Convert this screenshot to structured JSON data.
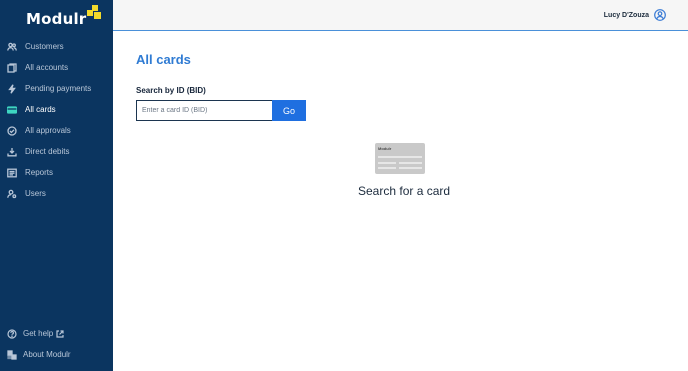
{
  "brand": {
    "name": "Modulr",
    "accent": "#f2da2c"
  },
  "sidebar": {
    "bg_color": "#0b3560",
    "active_color": "#3ed6c1",
    "items": [
      {
        "label": "Customers",
        "icon": "users-icon"
      },
      {
        "label": "All accounts",
        "icon": "accounts-icon"
      },
      {
        "label": "Pending payments",
        "icon": "bolt-icon"
      },
      {
        "label": "All cards",
        "icon": "card-icon",
        "active": true
      },
      {
        "label": "All approvals",
        "icon": "check-circle-icon"
      },
      {
        "label": "Direct debits",
        "icon": "download-icon"
      },
      {
        "label": "Reports",
        "icon": "report-icon"
      },
      {
        "label": "Users",
        "icon": "user-settings-icon"
      }
    ],
    "bottom": [
      {
        "label": "Get help",
        "icon": "help-icon"
      },
      {
        "label": "About Modulr",
        "icon": "about-icon"
      }
    ]
  },
  "header": {
    "user_name": "Lucy D'Zouza"
  },
  "main": {
    "title": "All cards",
    "search": {
      "label": "Search by ID (BID)",
      "placeholder": "Enter a card ID (BID)",
      "value": "",
      "button_label": "Go"
    },
    "empty_state": {
      "card_brand": "Modulr",
      "message": "Search for a card"
    }
  }
}
